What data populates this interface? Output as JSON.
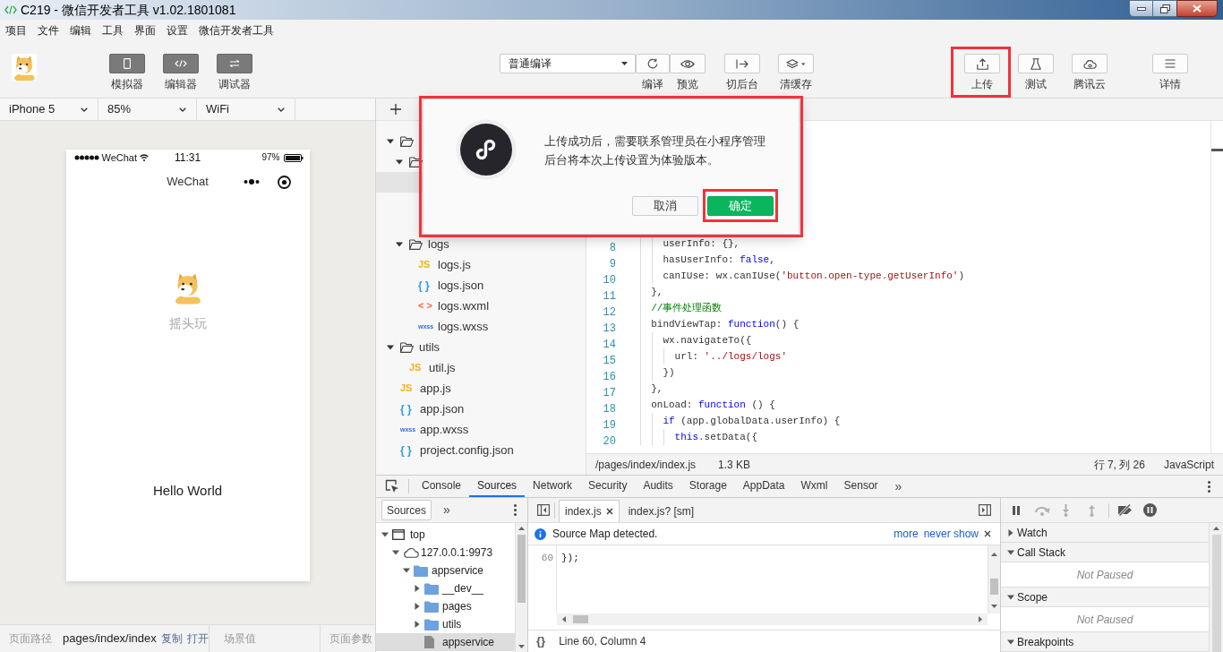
{
  "window": {
    "title": "C219 - 微信开发者工具 v1.02.1801081"
  },
  "menu": [
    "项目",
    "文件",
    "编辑",
    "工具",
    "界面",
    "设置",
    "微信开发者工具"
  ],
  "toolbar": {
    "view_toggles": [
      {
        "label": "模拟器",
        "kind": "phone",
        "on": true
      },
      {
        "label": "编辑器",
        "kind": "code",
        "on": true
      },
      {
        "label": "调试器",
        "kind": "debug",
        "on": true
      }
    ],
    "compile_mode": "普通编译",
    "compile_actions": [
      {
        "label": "编译",
        "kind": "refresh"
      },
      {
        "label": "预览",
        "kind": "eye"
      }
    ],
    "tools": [
      {
        "label": "切后台",
        "kind": "background"
      },
      {
        "label": "清缓存",
        "kind": "cache"
      }
    ],
    "publish_actions": [
      {
        "label": "上传",
        "kind": "upload",
        "highlighted": true
      },
      {
        "label": "测试",
        "kind": "test",
        "highlighted": false
      },
      {
        "label": "腾讯云",
        "kind": "cloud",
        "highlighted": false
      }
    ],
    "details": {
      "label": "详情",
      "kind": "menu"
    }
  },
  "simulator": {
    "device": "iPhone 5",
    "zoom": "85%",
    "network": "WiFi",
    "status_bar": {
      "carrier": "WeChat",
      "time": "11:31",
      "battery": "97%"
    },
    "nav_title": "WeChat",
    "nickname": "摇头玩",
    "motto": "Hello World"
  },
  "page_bar": {
    "path_label": "页面路径",
    "path": "pages/index/index",
    "actions": [
      "复制",
      "打开"
    ],
    "scene_label": "场景值",
    "params_label": "页面参数"
  },
  "file_tree": [
    {
      "kind": "folder",
      "expanded": true,
      "selected": false,
      "children": [
        {
          "kind": "folder",
          "expanded": true,
          "selected": false,
          "children": [
            {
              "selected": true
            },
            {
              "selected": false
            },
            {
              "selected": false
            }
          ]
        },
        {
          "kind": "folder",
          "label": "logs",
          "expanded": true,
          "selected": false,
          "children": [
            {
              "kind": "js",
              "badge": "JS",
              "label": "logs.js",
              "selected": false
            },
            {
              "kind": "json",
              "badge": "{ }",
              "label": "logs.json",
              "selected": false
            },
            {
              "kind": "wxml",
              "badge": "< >",
              "label": "logs.wxml",
              "selected": false
            },
            {
              "kind": "wxss",
              "badge": "wxss",
              "label": "logs.wxss",
              "selected": false
            }
          ]
        }
      ]
    },
    {
      "kind": "folder",
      "label": "utils",
      "expanded": true,
      "selected": false,
      "children": [
        {
          "kind": "js",
          "badge": "JS",
          "label": "util.js",
          "selected": false
        }
      ]
    },
    {
      "kind": "js",
      "badge": "JS",
      "label": "app.js",
      "selected": false
    },
    {
      "kind": "json",
      "badge": "{ }",
      "label": "app.json",
      "selected": false
    },
    {
      "kind": "wxss",
      "badge": "wxss",
      "label": "app.wxss",
      "selected": false
    },
    {
      "kind": "json",
      "badge": "{ }",
      "label": "project.config.json",
      "selected": false
    }
  ],
  "editor": {
    "lines": [
      {
        "number": "8",
        "tokens": [
          {
            "text": "    userInfo: {},",
            "kind": "plain"
          }
        ]
      },
      {
        "number": "9",
        "tokens": [
          {
            "text": "    hasUserInfo: ",
            "kind": "plain"
          },
          {
            "text": "false",
            "kind": "keyword"
          },
          {
            "text": ",",
            "kind": "plain"
          }
        ]
      },
      {
        "number": "10",
        "tokens": [
          {
            "text": "    canIUse: wx.canIUse(",
            "kind": "plain"
          },
          {
            "text": "'button.open-type.getUserInfo'",
            "kind": "string"
          },
          {
            "text": ")",
            "kind": "plain"
          }
        ]
      },
      {
        "number": "11",
        "tokens": [
          {
            "text": "  },",
            "kind": "plain"
          }
        ]
      },
      {
        "number": "12",
        "tokens": [
          {
            "text": "  //事件处理函数",
            "kind": "comment"
          }
        ]
      },
      {
        "number": "13",
        "tokens": [
          {
            "text": "  bindViewTap: ",
            "kind": "plain"
          },
          {
            "text": "function",
            "kind": "keyword"
          },
          {
            "text": "() {",
            "kind": "plain"
          }
        ]
      },
      {
        "number": "14",
        "tokens": [
          {
            "text": "    wx.navigateTo({",
            "kind": "plain"
          }
        ]
      },
      {
        "number": "15",
        "tokens": [
          {
            "text": "      url: ",
            "kind": "plain"
          },
          {
            "text": "'../logs/logs'",
            "kind": "string"
          }
        ]
      },
      {
        "number": "16",
        "tokens": [
          {
            "text": "    })",
            "kind": "plain"
          }
        ]
      },
      {
        "number": "17",
        "tokens": [
          {
            "text": "  },",
            "kind": "plain"
          }
        ]
      },
      {
        "number": "18",
        "tokens": [
          {
            "text": "  onLoad: ",
            "kind": "plain"
          },
          {
            "text": "function",
            "kind": "keyword"
          },
          {
            "text": " () {",
            "kind": "plain"
          }
        ]
      },
      {
        "number": "19",
        "tokens": [
          {
            "text": "    if",
            "kind": "keyword"
          },
          {
            "text": " (app.globalData.userInfo) {",
            "kind": "plain"
          }
        ]
      },
      {
        "number": "20",
        "tokens": [
          {
            "text": "      this",
            "kind": "keyword"
          },
          {
            "text": ".setData({",
            "kind": "plain"
          }
        ]
      }
    ],
    "status_bar": {
      "path": "/pages/index/index.js",
      "size": "1.3 KB",
      "cursor": "行 7, 列 26",
      "language": "JavaScript"
    }
  },
  "dialog": {
    "highlighted": true,
    "message": "上传成功后，需要联系管理员在小程序管理后台将本次上传设置为体验版本。",
    "buttons": [
      {
        "label": "取消",
        "kind": "secondary",
        "highlighted": false
      },
      {
        "label": "确定",
        "kind": "primary",
        "highlighted": true
      }
    ]
  },
  "devtools": {
    "tabs": [
      {
        "label": "Console",
        "selected": false
      },
      {
        "label": "Sources",
        "selected": true
      },
      {
        "label": "Network",
        "selected": false
      },
      {
        "label": "Security",
        "selected": false
      },
      {
        "label": "Audits",
        "selected": false
      },
      {
        "label": "Storage",
        "selected": false
      },
      {
        "label": "AppData",
        "selected": false
      },
      {
        "label": "Wxml",
        "selected": false
      },
      {
        "label": "Sensor",
        "selected": false
      }
    ],
    "more_tabs": "»",
    "navigator": {
      "tabs": [
        {
          "label": "Sources",
          "selected": true
        }
      ],
      "more_tabs": "»",
      "tree": [
        {
          "label": "top",
          "kind": "frame",
          "expanded": true,
          "selected": false,
          "children": [
            {
              "label": "127.0.0.1:9973",
              "kind": "origin",
              "expanded": true,
              "selected": false,
              "children": [
                {
                  "label": "appservice",
                  "kind": "folder",
                  "expanded": true,
                  "selected": false,
                  "children": [
                    {
                      "label": "__dev__",
                      "kind": "folder",
                      "expanded": false,
                      "selected": false
                    },
                    {
                      "label": "pages",
                      "kind": "folder",
                      "expanded": false,
                      "selected": false
                    },
                    {
                      "label": "utils",
                      "kind": "folder",
                      "expanded": false,
                      "selected": false
                    },
                    {
                      "label": "appservice",
                      "kind": "file",
                      "selected": true
                    }
                  ]
                }
              ]
            }
          ]
        }
      ]
    },
    "source_tabs": [
      {
        "label": "index.js",
        "selected": true,
        "closable": true
      },
      {
        "label": "index.js? [sm]",
        "selected": false,
        "closable": false
      }
    ],
    "infobar": {
      "message": "Source Map detected.",
      "links": [
        "more",
        "never show"
      ]
    },
    "code_lines": [
      {
        "number": "60",
        "text": "});"
      }
    ],
    "pretty_print": "{}",
    "status": "Line 60, Column 4",
    "debugger": {
      "controls": [
        {
          "kind": "pause",
          "disabled": false
        },
        {
          "kind": "step_over",
          "disabled": true
        },
        {
          "kind": "step_into",
          "disabled": true
        },
        {
          "kind": "step_out",
          "disabled": true
        },
        {
          "kind": "deactivate",
          "disabled": false
        },
        {
          "kind": "pause_exceptions",
          "disabled": false
        }
      ],
      "sections": [
        {
          "title": "Watch",
          "expanded": false
        },
        {
          "title": "Call Stack",
          "expanded": true,
          "content": "Not Paused"
        },
        {
          "title": "Scope",
          "expanded": true,
          "content": "Not Paused"
        },
        {
          "title": "Breakpoints",
          "expanded": true
        }
      ]
    }
  }
}
